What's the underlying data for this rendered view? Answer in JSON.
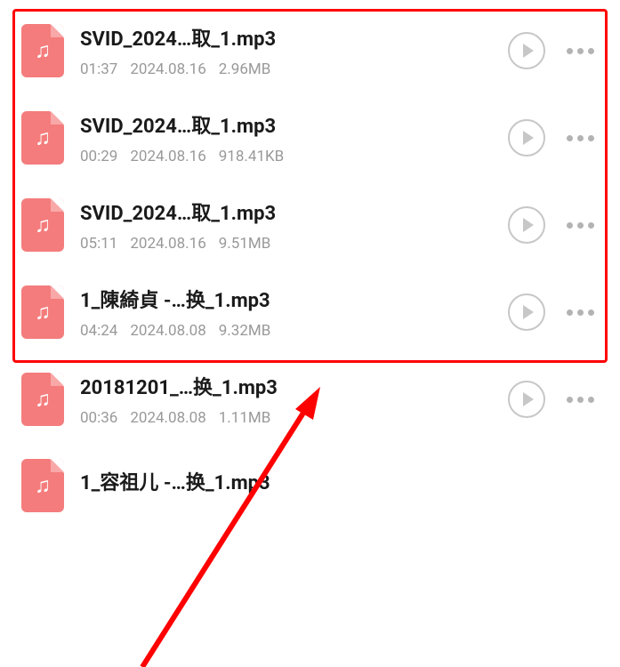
{
  "files": [
    {
      "name": "SVID_2024…取_1.mp3",
      "duration": "01:37",
      "date": "2024.08.16",
      "size": "2.96MB"
    },
    {
      "name": "SVID_2024…取_1.mp3",
      "duration": "00:29",
      "date": "2024.08.16",
      "size": "918.41KB"
    },
    {
      "name": "SVID_2024…取_1.mp3",
      "duration": "05:11",
      "date": "2024.08.16",
      "size": "9.51MB"
    },
    {
      "name": "1_陳綺貞 -…换_1.mp3",
      "duration": "04:24",
      "date": "2024.08.08",
      "size": "9.32MB"
    },
    {
      "name": "20181201_…换_1.mp3",
      "duration": "00:36",
      "date": "2024.08.08",
      "size": "1.11MB"
    },
    {
      "name": "1_容祖儿 -…换_1.mp3",
      "duration": "",
      "date": "",
      "size": ""
    }
  ]
}
